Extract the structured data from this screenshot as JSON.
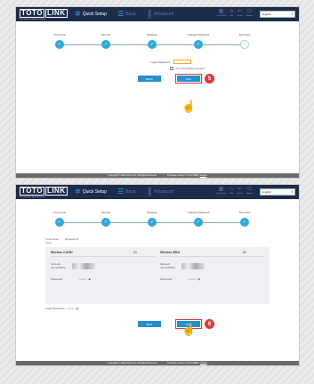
{
  "header": {
    "logo_part1": "TOTO",
    "logo_part2": "LINK",
    "tagline": "The Smartest Network Device",
    "nav": [
      {
        "label": "Quick Setup",
        "icon": "gear-icon"
      },
      {
        "label": "Basic",
        "icon": "list-icon"
      },
      {
        "label": "Advanced",
        "icon": "bars-icon"
      }
    ],
    "tools": [
      {
        "label": "Quick Setup",
        "icon": "qr-icon"
      },
      {
        "label": "Wifi",
        "icon": "lock-icon"
      },
      {
        "label": "Logout",
        "icon": "exit-icon"
      },
      {
        "label": "Reboot",
        "icon": "power-icon"
      }
    ],
    "language": "English"
  },
  "steps": [
    {
      "label": "Time Zone"
    },
    {
      "label": "Internet"
    },
    {
      "label": "Wireless"
    },
    {
      "label": "Change Password"
    },
    {
      "label": "Summary"
    }
  ],
  "shot1": {
    "login_password_label": "Login Password:",
    "checkbox_label": "Use 2.4G wireless password",
    "back_label": "BACK",
    "next_label": "Next",
    "badge": "5"
  },
  "shot2": {
    "connection_label": "Connection Type:",
    "connection_value": "Dynamic IP",
    "panel_left_title": "Wireless 2.4GHz",
    "panel_right_title": "Wireless 5GHz",
    "on_label": "On",
    "ssid_label": "Network name(SSID):",
    "password_label": "Password:",
    "password_mask": "••••••••",
    "login_password_label": "Login Password:",
    "back_label": "Back",
    "save_label": "Save",
    "badge": "6"
  },
  "footer": {
    "copyright": "Copyright © 2018 Zonet Ltd., All Rights Reserved",
    "firmware": "Firmware version: V7.4cu.5668",
    "logout": "Logout"
  },
  "accent_color": "#2fa8dd",
  "highlight_color": "#e53935"
}
